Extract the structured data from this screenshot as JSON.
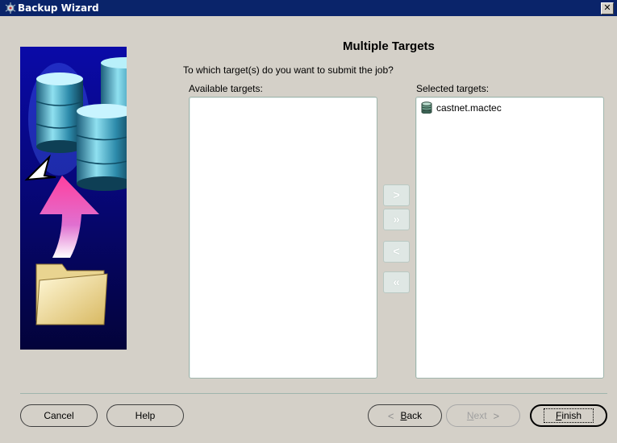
{
  "window": {
    "title": "Backup Wizard",
    "close_glyph": "✕"
  },
  "header": {
    "title": "Multiple Targets",
    "prompt": "To which target(s) do you want to submit the job?"
  },
  "available": {
    "label": "Available targets:",
    "items": []
  },
  "selected": {
    "label": "Selected targets:",
    "items": [
      {
        "icon": "database-icon",
        "label": "castnet.mactec"
      }
    ]
  },
  "shuttle": {
    "move": ">",
    "move_all": "»",
    "remove": "<",
    "remove_all": "«"
  },
  "buttons": {
    "cancel": "Cancel",
    "help": "Help",
    "back": {
      "mnemonic": "B",
      "rest": "ack"
    },
    "next": {
      "mnemonic": "N",
      "rest": "ext"
    },
    "finish": {
      "mnemonic": "F",
      "rest": "inish"
    }
  },
  "colors": {
    "titlebar": "#0a246a",
    "dialog": "#d4d0c8",
    "border": "#9fb5ad"
  }
}
